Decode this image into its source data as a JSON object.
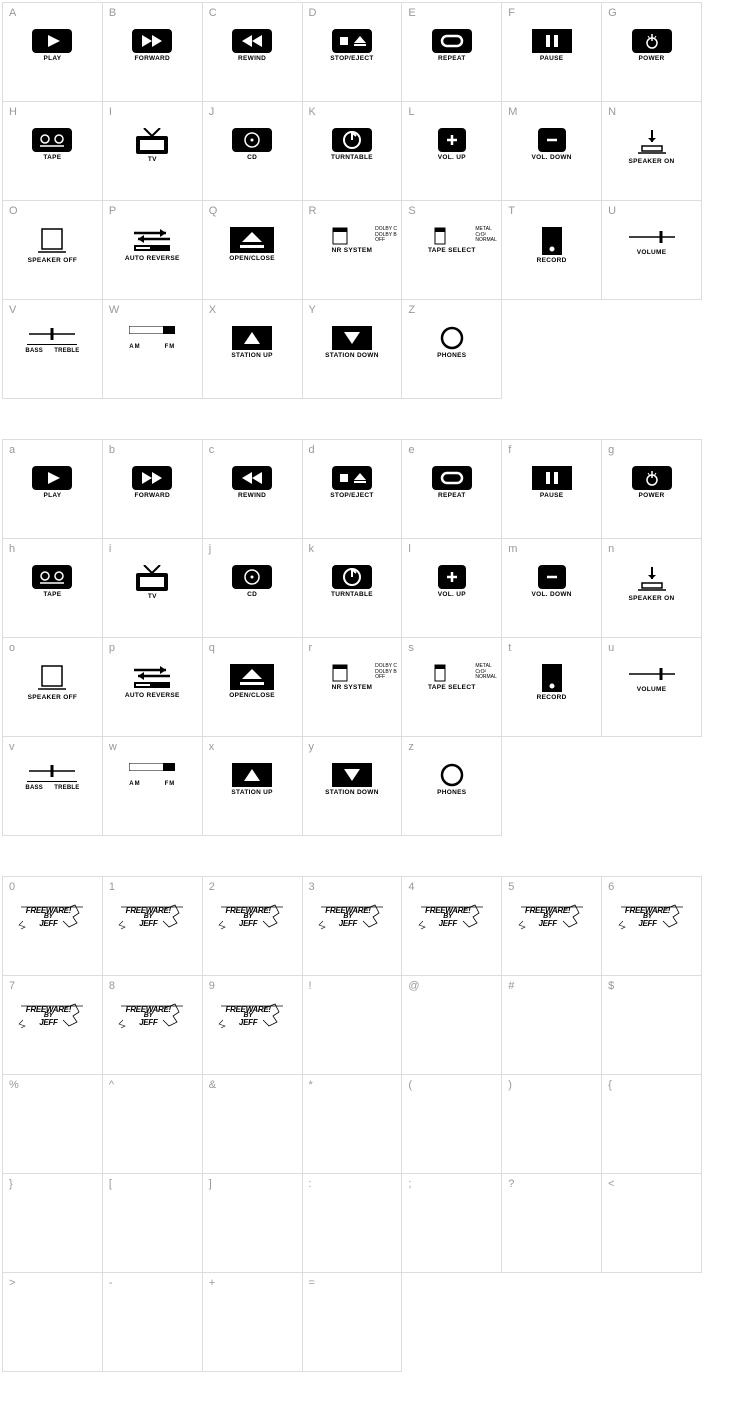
{
  "sections": [
    {
      "rows": [
        [
          {
            "key": "A",
            "type": "play",
            "label": "PLAY"
          },
          {
            "key": "B",
            "type": "forward",
            "label": "FORWARD"
          },
          {
            "key": "C",
            "type": "rewind",
            "label": "REWIND"
          },
          {
            "key": "D",
            "type": "stopeject",
            "label": "STOP/EJECT"
          },
          {
            "key": "E",
            "type": "repeat",
            "label": "REPEAT"
          },
          {
            "key": "F",
            "type": "pause",
            "label": "PAUSE"
          },
          {
            "key": "G",
            "type": "power",
            "label": "POWER"
          }
        ],
        [
          {
            "key": "H",
            "type": "tape",
            "label": "TAPE"
          },
          {
            "key": "I",
            "type": "tv",
            "label": "TV"
          },
          {
            "key": "J",
            "type": "cd",
            "label": "CD"
          },
          {
            "key": "K",
            "type": "turntable",
            "label": "TURNTABLE"
          },
          {
            "key": "L",
            "type": "volup",
            "label": "VOL. UP"
          },
          {
            "key": "M",
            "type": "voldown",
            "label": "VOL. DOWN"
          },
          {
            "key": "N",
            "type": "speakeron",
            "label": "SPEAKER ON"
          }
        ],
        [
          {
            "key": "O",
            "type": "speakeroff",
            "label": "SPEAKER OFF"
          },
          {
            "key": "P",
            "type": "autoreverse",
            "label": "AUTO REVERSE"
          },
          {
            "key": "Q",
            "type": "openclose",
            "label": "OPEN/CLOSE"
          },
          {
            "key": "R",
            "type": "nrsystem",
            "label": "NR SYSTEM",
            "lines": [
              "DOLBY C",
              "DOLBY B",
              "OFF"
            ]
          },
          {
            "key": "S",
            "type": "tapeselect",
            "label": "TAPE SELECT",
            "lines": [
              "METAL",
              "CrO²",
              "NORMAL"
            ]
          },
          {
            "key": "T",
            "type": "record",
            "label": "RECORD"
          },
          {
            "key": "U",
            "type": "volume",
            "label": "VOLUME"
          }
        ],
        [
          {
            "key": "V",
            "type": "basstreble",
            "label": "",
            "left": "BASS",
            "right": "TREBLE"
          },
          {
            "key": "W",
            "type": "amfm",
            "label": "",
            "left": "AM",
            "right": "FM"
          },
          {
            "key": "X",
            "type": "stationup",
            "label": "STATION UP"
          },
          {
            "key": "Y",
            "type": "stationdown",
            "label": "STATION DOWN"
          },
          {
            "key": "Z",
            "type": "phones",
            "label": "PHONES"
          },
          {
            "empty": true
          },
          {
            "empty": true
          }
        ]
      ]
    },
    {
      "rows": [
        [
          {
            "key": "a",
            "type": "play",
            "label": "PLAY"
          },
          {
            "key": "b",
            "type": "forward",
            "label": "FORWARD"
          },
          {
            "key": "c",
            "type": "rewind",
            "label": "REWIND"
          },
          {
            "key": "d",
            "type": "stopeject",
            "label": "STOP/EJECT"
          },
          {
            "key": "e",
            "type": "repeat",
            "label": "REPEAT"
          },
          {
            "key": "f",
            "type": "pause",
            "label": "PAUSE"
          },
          {
            "key": "g",
            "type": "power",
            "label": "POWER"
          }
        ],
        [
          {
            "key": "h",
            "type": "tape",
            "label": "TAPE"
          },
          {
            "key": "i",
            "type": "tv",
            "label": "TV"
          },
          {
            "key": "j",
            "type": "cd",
            "label": "CD"
          },
          {
            "key": "k",
            "type": "turntable",
            "label": "TURNTABLE"
          },
          {
            "key": "l",
            "type": "volup",
            "label": "VOL. UP"
          },
          {
            "key": "m",
            "type": "voldown",
            "label": "VOL. DOWN"
          },
          {
            "key": "n",
            "type": "speakeron",
            "label": "SPEAKER ON"
          }
        ],
        [
          {
            "key": "o",
            "type": "speakeroff",
            "label": "SPEAKER OFF"
          },
          {
            "key": "p",
            "type": "autoreverse",
            "label": "AUTO REVERSE"
          },
          {
            "key": "q",
            "type": "openclose",
            "label": "OPEN/CLOSE"
          },
          {
            "key": "r",
            "type": "nrsystem",
            "label": "NR SYSTEM",
            "lines": [
              "DOLBY C",
              "DOLBY B",
              "OFF"
            ]
          },
          {
            "key": "s",
            "type": "tapeselect",
            "label": "TAPE SELECT",
            "lines": [
              "METAL",
              "CrO²",
              "NORMAL"
            ]
          },
          {
            "key": "t",
            "type": "record",
            "label": "RECORD"
          },
          {
            "key": "u",
            "type": "volume",
            "label": "VOLUME"
          }
        ],
        [
          {
            "key": "v",
            "type": "basstreble",
            "label": "",
            "left": "BASS",
            "right": "TREBLE"
          },
          {
            "key": "w",
            "type": "amfm",
            "label": "",
            "left": "AM",
            "right": "FM"
          },
          {
            "key": "x",
            "type": "stationup",
            "label": "STATION UP"
          },
          {
            "key": "y",
            "type": "stationdown",
            "label": "STATION DOWN"
          },
          {
            "key": "z",
            "type": "phones",
            "label": "PHONES"
          },
          {
            "empty": true
          },
          {
            "empty": true
          }
        ]
      ]
    },
    {
      "rows": [
        [
          {
            "key": "0",
            "type": "freeware",
            "l1": "FREEWARE!",
            "l2": "BY",
            "l3": "JEFF"
          },
          {
            "key": "1",
            "type": "freeware",
            "l1": "FREEWARE!",
            "l2": "BY",
            "l3": "JEFF"
          },
          {
            "key": "2",
            "type": "freeware",
            "l1": "FREEWARE!",
            "l2": "BY",
            "l3": "JEFF"
          },
          {
            "key": "3",
            "type": "freeware",
            "l1": "FREEWARE!",
            "l2": "BY",
            "l3": "JEFF"
          },
          {
            "key": "4",
            "type": "freeware",
            "l1": "FREEWARE!",
            "l2": "BY",
            "l3": "JEFF"
          },
          {
            "key": "5",
            "type": "freeware",
            "l1": "FREEWARE!",
            "l2": "BY",
            "l3": "JEFF"
          },
          {
            "key": "6",
            "type": "freeware",
            "l1": "FREEWARE!",
            "l2": "BY",
            "l3": "JEFF"
          }
        ],
        [
          {
            "key": "7",
            "type": "freeware",
            "l1": "FREEWARE!",
            "l2": "BY",
            "l3": "JEFF"
          },
          {
            "key": "8",
            "type": "freeware",
            "l1": "FREEWARE!",
            "l2": "BY",
            "l3": "JEFF"
          },
          {
            "key": "9",
            "type": "freeware",
            "l1": "FREEWARE!",
            "l2": "BY",
            "l3": "JEFF"
          },
          {
            "key": "!",
            "type": "blank"
          },
          {
            "key": "@",
            "type": "blank"
          },
          {
            "key": "#",
            "type": "blank"
          },
          {
            "key": "$",
            "type": "blank"
          }
        ],
        [
          {
            "key": "%",
            "type": "blank"
          },
          {
            "key": "^",
            "type": "blank"
          },
          {
            "key": "&",
            "type": "blank"
          },
          {
            "key": "*",
            "type": "blank"
          },
          {
            "key": "(",
            "type": "blank"
          },
          {
            "key": ")",
            "type": "blank"
          },
          {
            "key": "{",
            "type": "blank"
          }
        ],
        [
          {
            "key": "}",
            "type": "blank"
          },
          {
            "key": "[",
            "type": "blank"
          },
          {
            "key": "]",
            "type": "blank"
          },
          {
            "key": ":",
            "type": "blank"
          },
          {
            "key": ";",
            "type": "blank"
          },
          {
            "key": "?",
            "type": "blank"
          },
          {
            "key": "<",
            "type": "blank"
          }
        ],
        [
          {
            "key": ">",
            "type": "blank"
          },
          {
            "key": "-",
            "type": "blank"
          },
          {
            "key": "+",
            "type": "blank"
          },
          {
            "key": "=",
            "type": "blank"
          },
          {
            "empty": true
          },
          {
            "empty": true
          },
          {
            "empty": true
          }
        ]
      ]
    }
  ]
}
